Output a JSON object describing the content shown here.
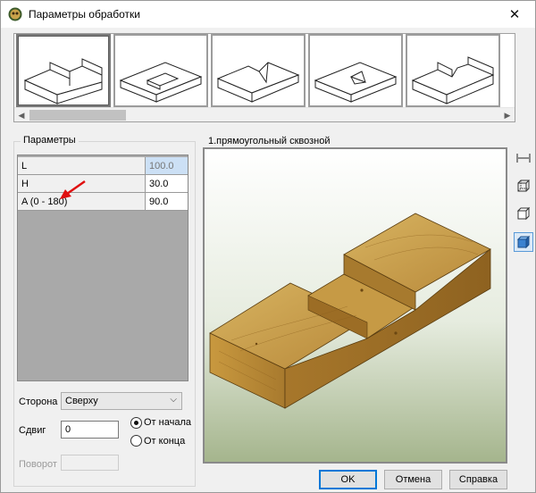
{
  "window": {
    "title": "Параметры обработки"
  },
  "thumbnails": [
    {
      "name": "thumb-1",
      "selected": true
    },
    {
      "name": "thumb-2",
      "selected": false
    },
    {
      "name": "thumb-3",
      "selected": false
    },
    {
      "name": "thumb-4",
      "selected": false
    },
    {
      "name": "thumb-5",
      "selected": false
    }
  ],
  "params": {
    "group_label": "Параметры",
    "rows": [
      {
        "name": "L",
        "value": "100.0"
      },
      {
        "name": "H",
        "value": "30.0"
      },
      {
        "name": "A (0 - 180)",
        "value": "90.0"
      }
    ]
  },
  "controls": {
    "side_label": "Сторона",
    "side_value": "Сверху",
    "shift_label": "Сдвиг",
    "shift_value": "0",
    "radio_from_start": "От начала",
    "radio_from_end": "От конца",
    "rotate_label": "Поворот",
    "rotate_value": ""
  },
  "preview": {
    "title": "1.прямоугольный сквозной"
  },
  "buttons": {
    "ok": "OK",
    "cancel": "Отмена",
    "help": "Справка"
  },
  "colors": {
    "accent": "#0078d7",
    "wood_top": "#c9a24a",
    "wood_side": "#a8782c"
  }
}
